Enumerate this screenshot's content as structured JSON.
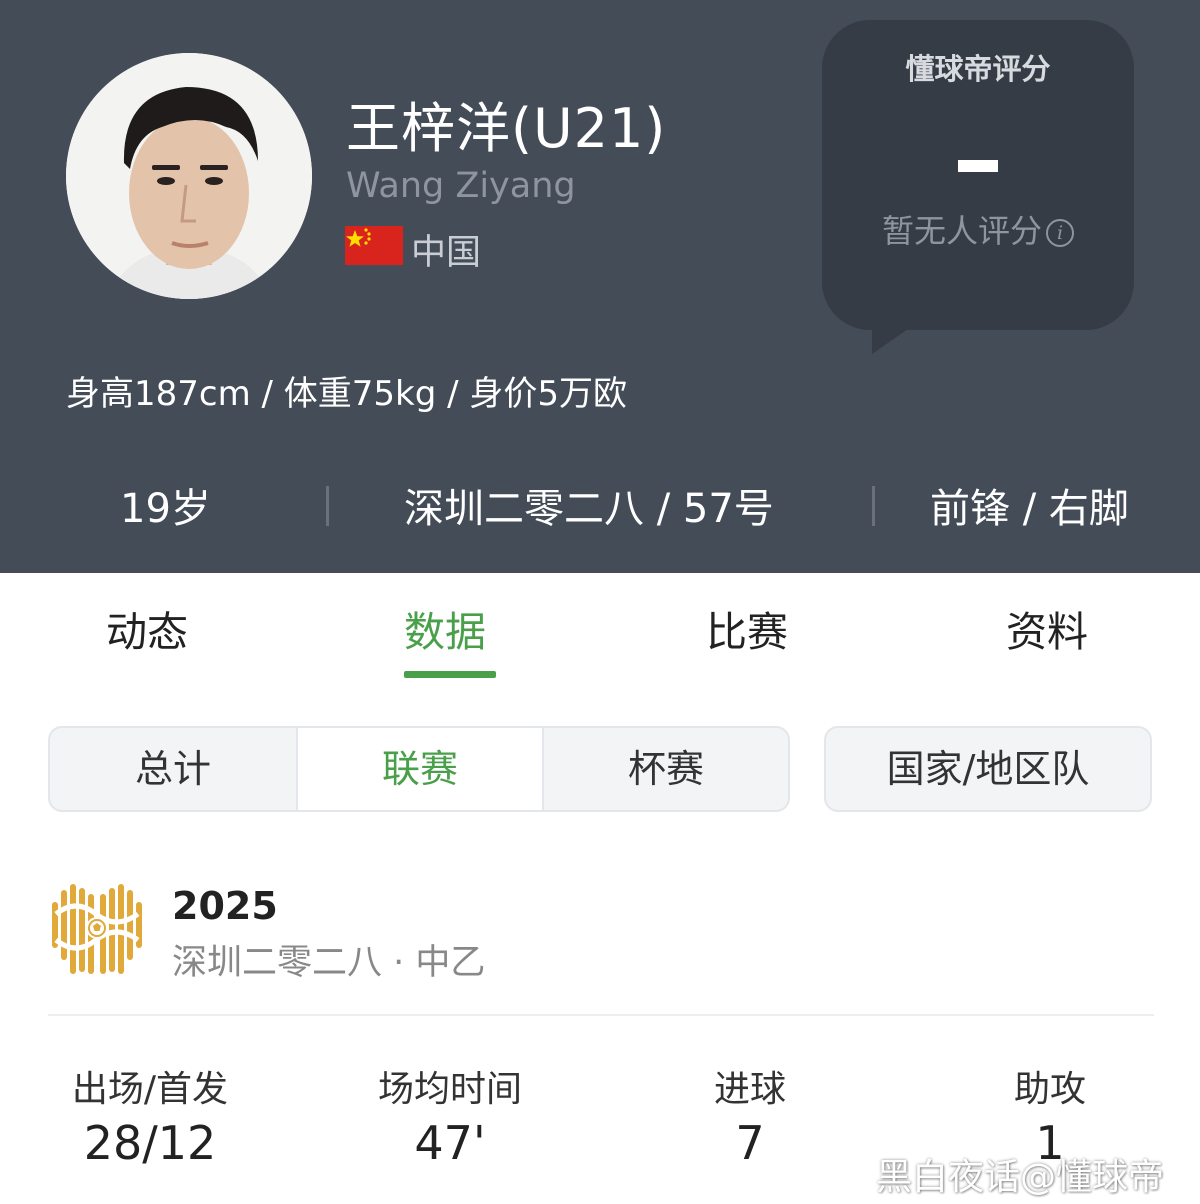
{
  "player": {
    "name": "王梓洋(U21)",
    "english_name": "Wang Ziyang",
    "nationality": "中国",
    "physical": "身高187cm / 体重75kg / 身价5万欧",
    "age": "19岁",
    "club_number": "深圳二零二八 / 57号",
    "position_foot": "前锋 / 右脚"
  },
  "rating": {
    "title": "懂球帝评分",
    "value": "-",
    "note": "暂无人评分",
    "info_glyph": "i"
  },
  "tabs": [
    {
      "label": "动态",
      "active": false
    },
    {
      "label": "数据",
      "active": true
    },
    {
      "label": "比赛",
      "active": false
    },
    {
      "label": "资料",
      "active": false
    }
  ],
  "filters": {
    "segment": [
      "总计",
      "联赛",
      "杯赛"
    ],
    "selected": "联赛",
    "national_team": "国家/地区队"
  },
  "competition": {
    "season": "2025",
    "team_league": "深圳二零二八 · 中乙"
  },
  "stats": [
    {
      "label": "出场/首发",
      "value": "28/12"
    },
    {
      "label": "场均时间",
      "value": "47'"
    },
    {
      "label": "进球",
      "value": "7"
    },
    {
      "label": "助攻",
      "value": "1"
    }
  ],
  "watermark": "黑白夜话@懂球帝",
  "colors": {
    "header_bg": "#444c57",
    "rating_bubble_bg": "#363c45",
    "accent_green": "#4aa04a",
    "flag_red": "#d9231d",
    "flag_yellow": "#ffde00",
    "logo_gold": "#e0a93a"
  }
}
